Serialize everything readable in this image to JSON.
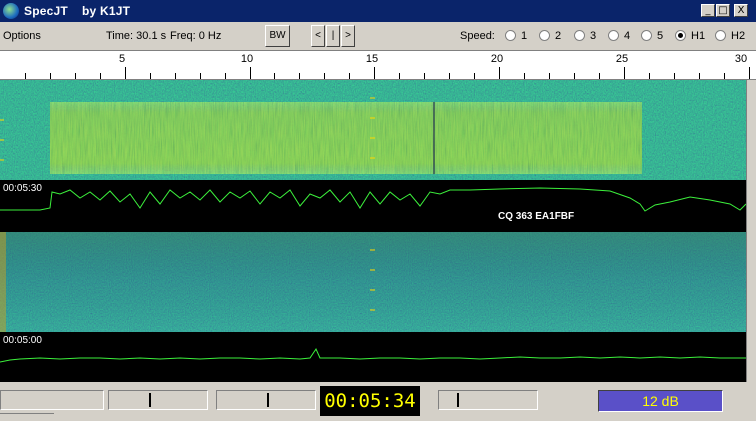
{
  "window": {
    "title": "SpecJT    by K1JT",
    "buttons": [
      "_",
      "□",
      "X"
    ]
  },
  "toolbar": {
    "options_label": "Options",
    "time_text": "Time: 30.1 s",
    "freq_text": "Freq: 0 Hz",
    "bw_label": "BW",
    "nav_left": "<",
    "nav_mid": "|",
    "nav_right": ">",
    "speed_label": "Speed:",
    "speed_options": [
      "1",
      "2",
      "3",
      "4",
      "5",
      "H1",
      "H2"
    ],
    "speed_selected": "H1"
  },
  "ruler": {
    "labels": [
      "5",
      "10",
      "15",
      "20",
      "25",
      "30"
    ]
  },
  "display": {
    "upper_timestamp": "00:05:30",
    "lower_timestamp": "00:05:00",
    "decoded_text": "CQ 363 EA1FBF",
    "trace_color": "#3cf03c"
  },
  "status": {
    "clock": "00:05:34",
    "level": "12 dB"
  },
  "colors": {
    "titlebar": "#0a246a",
    "clock_fg": "#ffff00",
    "level_bg": "#5a50c8"
  }
}
